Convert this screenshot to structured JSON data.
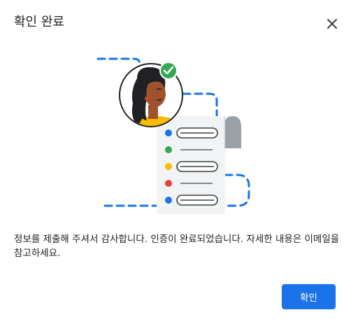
{
  "dialog": {
    "title": "확인 완료",
    "message": "정보를 제출해 주셔서 감사합니다. 인증이 완료되었습니다. 자세한 내용은 이메일을 참고하세요.",
    "confirm_label": "확인",
    "close_icon": "close-icon"
  },
  "colors": {
    "primary": "#1a73e8",
    "success": "#34a853",
    "warning": "#fbbc04",
    "error": "#ea4335",
    "text": "#202124"
  }
}
